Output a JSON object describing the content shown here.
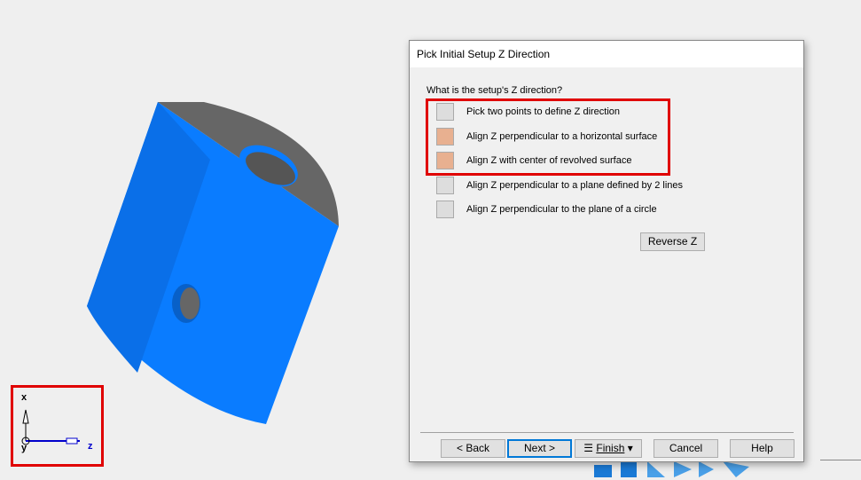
{
  "dialog": {
    "title": "Pick Initial Setup Z Direction",
    "question": "What is the setup's Z direction?",
    "options": [
      {
        "label": "Pick two points to define Z direction",
        "icon": "two-points-arrow-icon"
      },
      {
        "label": "Align Z perpendicular to a  horizontal surface",
        "icon": "surface-icon"
      },
      {
        "label": "Align Z with center of revolved surface",
        "icon": "revolved-surface-icon"
      },
      {
        "label": "Align Z perpendicular to a plane defined by 2 lines",
        "icon": "two-lines-icon"
      },
      {
        "label": "Align Z perpendicular to the plane of a circle",
        "icon": "circle-icon"
      }
    ],
    "reverse": "Reverse Z",
    "back": "< Back",
    "next": "Next >",
    "finish": "Finish",
    "cancel": "Cancel",
    "help": "Help"
  },
  "axes": {
    "x": "x",
    "y": "y",
    "z": "z"
  },
  "colors": {
    "part": "#0a7cff",
    "highlight": "#e00000"
  }
}
